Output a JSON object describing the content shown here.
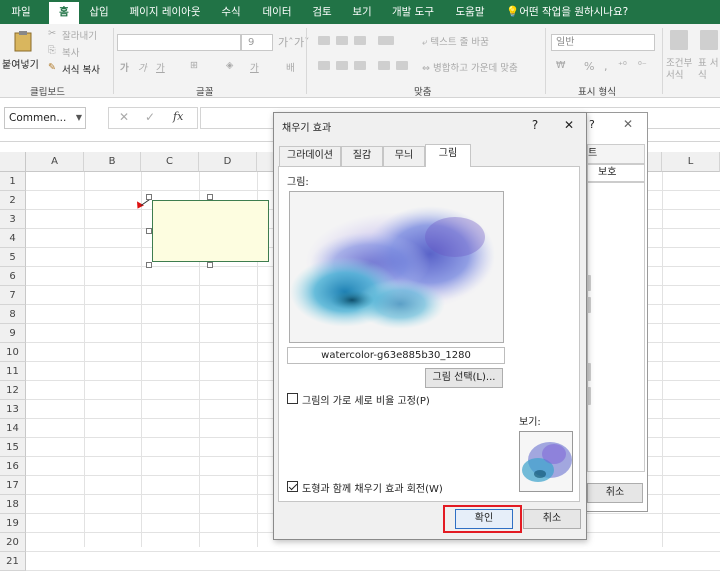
{
  "ribbon_tabs": [
    "파일",
    "홈",
    "삽입",
    "페이지 레이아웃",
    "수식",
    "데이터",
    "검토",
    "보기",
    "개발 도구",
    "도움말",
    "어떤 작업을 원하시나요?"
  ],
  "active_tab": "홈",
  "clipboard": {
    "paste": "붙여넣기",
    "cut": "잘라내기",
    "copy": "복사",
    "format_painter": "서식 복사",
    "group_label": "클립보드"
  },
  "font": {
    "size": "9",
    "group_label": "글꼴"
  },
  "alignment": {
    "wrap": "텍스트 줄 바꿈",
    "merge": "병합하고 가운데 맞춤",
    "group_label": "맞춤"
  },
  "number": {
    "format": "일반",
    "group_label": "표시 형식"
  },
  "styles": {
    "conditional": "조건부 서식",
    "table": "표 서식"
  },
  "formula_bar": {
    "name_box": "Commen..."
  },
  "columns": [
    "A",
    "B",
    "C",
    "D",
    "L"
  ],
  "rows": [
    "1",
    "2",
    "3",
    "4",
    "5",
    "6",
    "7",
    "8",
    "9",
    "10",
    "11",
    "12",
    "13",
    "14",
    "15",
    "16",
    "17",
    "18",
    "19",
    "20",
    "21"
  ],
  "back_dialog": {
    "header": "트",
    "tab": "보호",
    "cancel": "취소"
  },
  "dialog": {
    "title": "채우기 효과",
    "help": "?",
    "close": "✕",
    "tabs": [
      "그라데이션",
      "질감",
      "무늬",
      "그림"
    ],
    "active_tab": "그림",
    "picture_label": "그림:",
    "filename": "watercolor-g63e885b30_1280",
    "select_picture": "그림 선택(L)...",
    "lock_aspect": "그림의 가로 세로 비율 고정(P)",
    "rotate_with_shape": "도형과 함께 채우기 효과 회전(W)",
    "sample_label": "보기:",
    "ok": "확인",
    "cancel": "취소"
  },
  "colors": {
    "excel_green": "#217346",
    "highlight": "#e31b23"
  }
}
